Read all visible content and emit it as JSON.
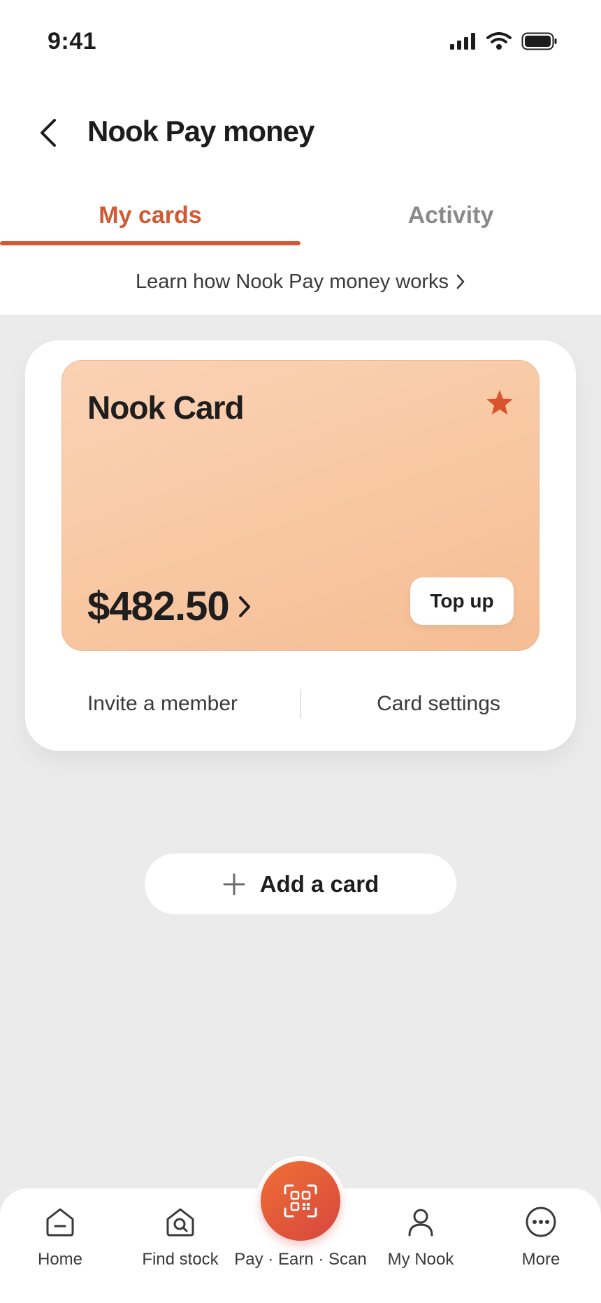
{
  "status_bar": {
    "time": "9:41"
  },
  "header": {
    "title": "Nook Pay money"
  },
  "tabs": [
    {
      "label": "My cards",
      "active": true
    },
    {
      "label": "Activity",
      "active": false
    }
  ],
  "learn_link": {
    "label": "Learn how Nook Pay money works"
  },
  "card": {
    "name": "Nook Card",
    "balance": "$482.50",
    "top_up_label": "Top up",
    "actions": {
      "invite": "Invite a member",
      "settings": "Card settings"
    }
  },
  "add_card": {
    "label": "Add a card"
  },
  "tab_bar": {
    "items": [
      {
        "label": "Home",
        "icon": "home-icon"
      },
      {
        "label": "Find stock",
        "icon": "find-stock-icon"
      },
      {
        "label": "Pay · Earn · Scan",
        "icon": "qr-scan-icon"
      },
      {
        "label": "My Nook",
        "icon": "person-icon"
      },
      {
        "label": "More",
        "icon": "more-icon"
      }
    ]
  },
  "colors": {
    "accent": "#cf5a33",
    "card_gradient_start": "#fbd2b5",
    "card_gradient_end": "#f5bd94",
    "star": "#d9532f",
    "scan_button_start": "#ef6f35",
    "scan_button_end": "#d6473e",
    "background": "#ebebeb"
  }
}
